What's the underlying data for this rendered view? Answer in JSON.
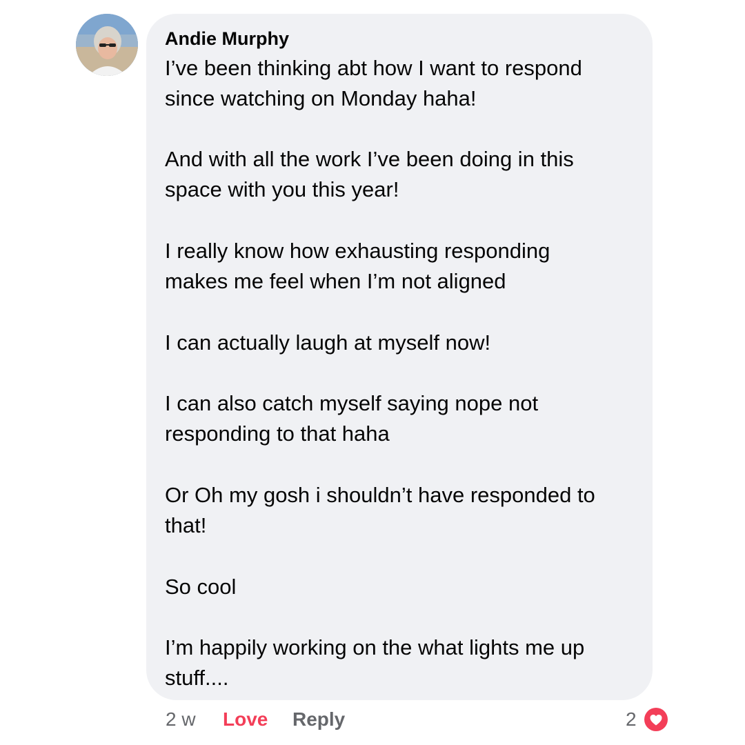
{
  "comment": {
    "author": "Andie Murphy",
    "lines": [
      "I’ve been thinking abt how I want to respond",
      "since watching on Monday haha!",
      "And with all the work I’ve been doing in this",
      "space with you this year!",
      "I really know how exhausting responding",
      "makes me feel when I’m not aligned",
      "I can actually laugh at myself now!",
      "I can also catch myself saying nope not",
      "responding to that haha",
      "Or Oh my gosh i shouldn’t have responded to",
      "that!",
      "So cool",
      "I’m happily working on the what lights me up",
      "stuff...."
    ]
  },
  "actions": {
    "time": "2 w",
    "love_label": "Love",
    "reply_label": "Reply"
  },
  "reactions": {
    "count": "2",
    "icon": "heart-icon"
  },
  "colors": {
    "bubble": "#f0f1f4",
    "love": "#f33e58",
    "muted": "#65676b",
    "heart": "#f33e58"
  }
}
